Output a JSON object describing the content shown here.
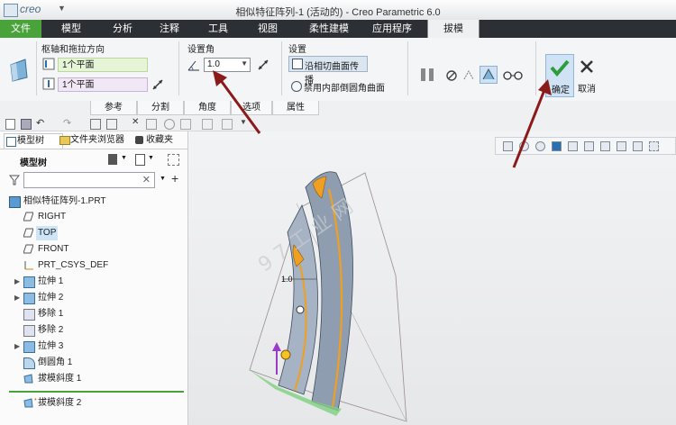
{
  "titlebar": {
    "app_logo": "creo",
    "window_title": "相似特征阵列-1 (活动的) - Creo Parametric 6.0"
  },
  "ribbon_tabs": [
    "文件",
    "模型",
    "分析",
    "注释",
    "工具",
    "视图",
    "柔性建模",
    "应用程序",
    "拔模"
  ],
  "ribbon": {
    "pivot_group_title": "枢轴和拖拉方向",
    "pivot_field_1": "1个平面",
    "pivot_field_2": "1个平面",
    "angle_group_title": "设置角",
    "angle_value": "1.0",
    "settings_group_title": "设置",
    "propagate_label": "沿相切曲面传播",
    "disable_round_label": "禁用内部倒圆角曲面",
    "ok_label": "确定",
    "cancel_label": "取消"
  },
  "subtabs": [
    "参考",
    "分割",
    "角度",
    "选项",
    "属性"
  ],
  "panel": {
    "tabs": [
      "模型树",
      "文件夹浏览器",
      "收藏夹"
    ],
    "tree_title": "模型树",
    "search_placeholder": "",
    "items": [
      {
        "label": "相似特征阵列-1.PRT",
        "icon": "part-icon"
      },
      {
        "label": "RIGHT",
        "icon": "datum-plane-icon"
      },
      {
        "label": "TOP",
        "icon": "datum-plane-icon"
      },
      {
        "label": "FRONT",
        "icon": "datum-plane-icon"
      },
      {
        "label": "PRT_CSYS_DEF",
        "icon": "csys-icon"
      },
      {
        "label": "拉伸 1",
        "icon": "extrude-icon"
      },
      {
        "label": "拉伸 2",
        "icon": "extrude-icon"
      },
      {
        "label": "移除 1",
        "icon": "remove-icon"
      },
      {
        "label": "移除 2",
        "icon": "remove-icon"
      },
      {
        "label": "拉伸 3",
        "icon": "extrude-icon"
      },
      {
        "label": "倒圆角 1",
        "icon": "round-icon"
      },
      {
        "label": "拔模斜度 1",
        "icon": "draft-icon"
      }
    ],
    "insert_item": "拔模斜度 2"
  },
  "graphics": {
    "angle_annotation": "1.0",
    "watermark": "9 7 工 业 网"
  },
  "colors": {
    "file_tab": "#4aa33a",
    "tab_bar": "#2c3035",
    "arrow": "#8b1a1a",
    "part_body": "#8e9db0",
    "part_edge": "#f0a020",
    "ok_check": "#2e9c3a"
  }
}
